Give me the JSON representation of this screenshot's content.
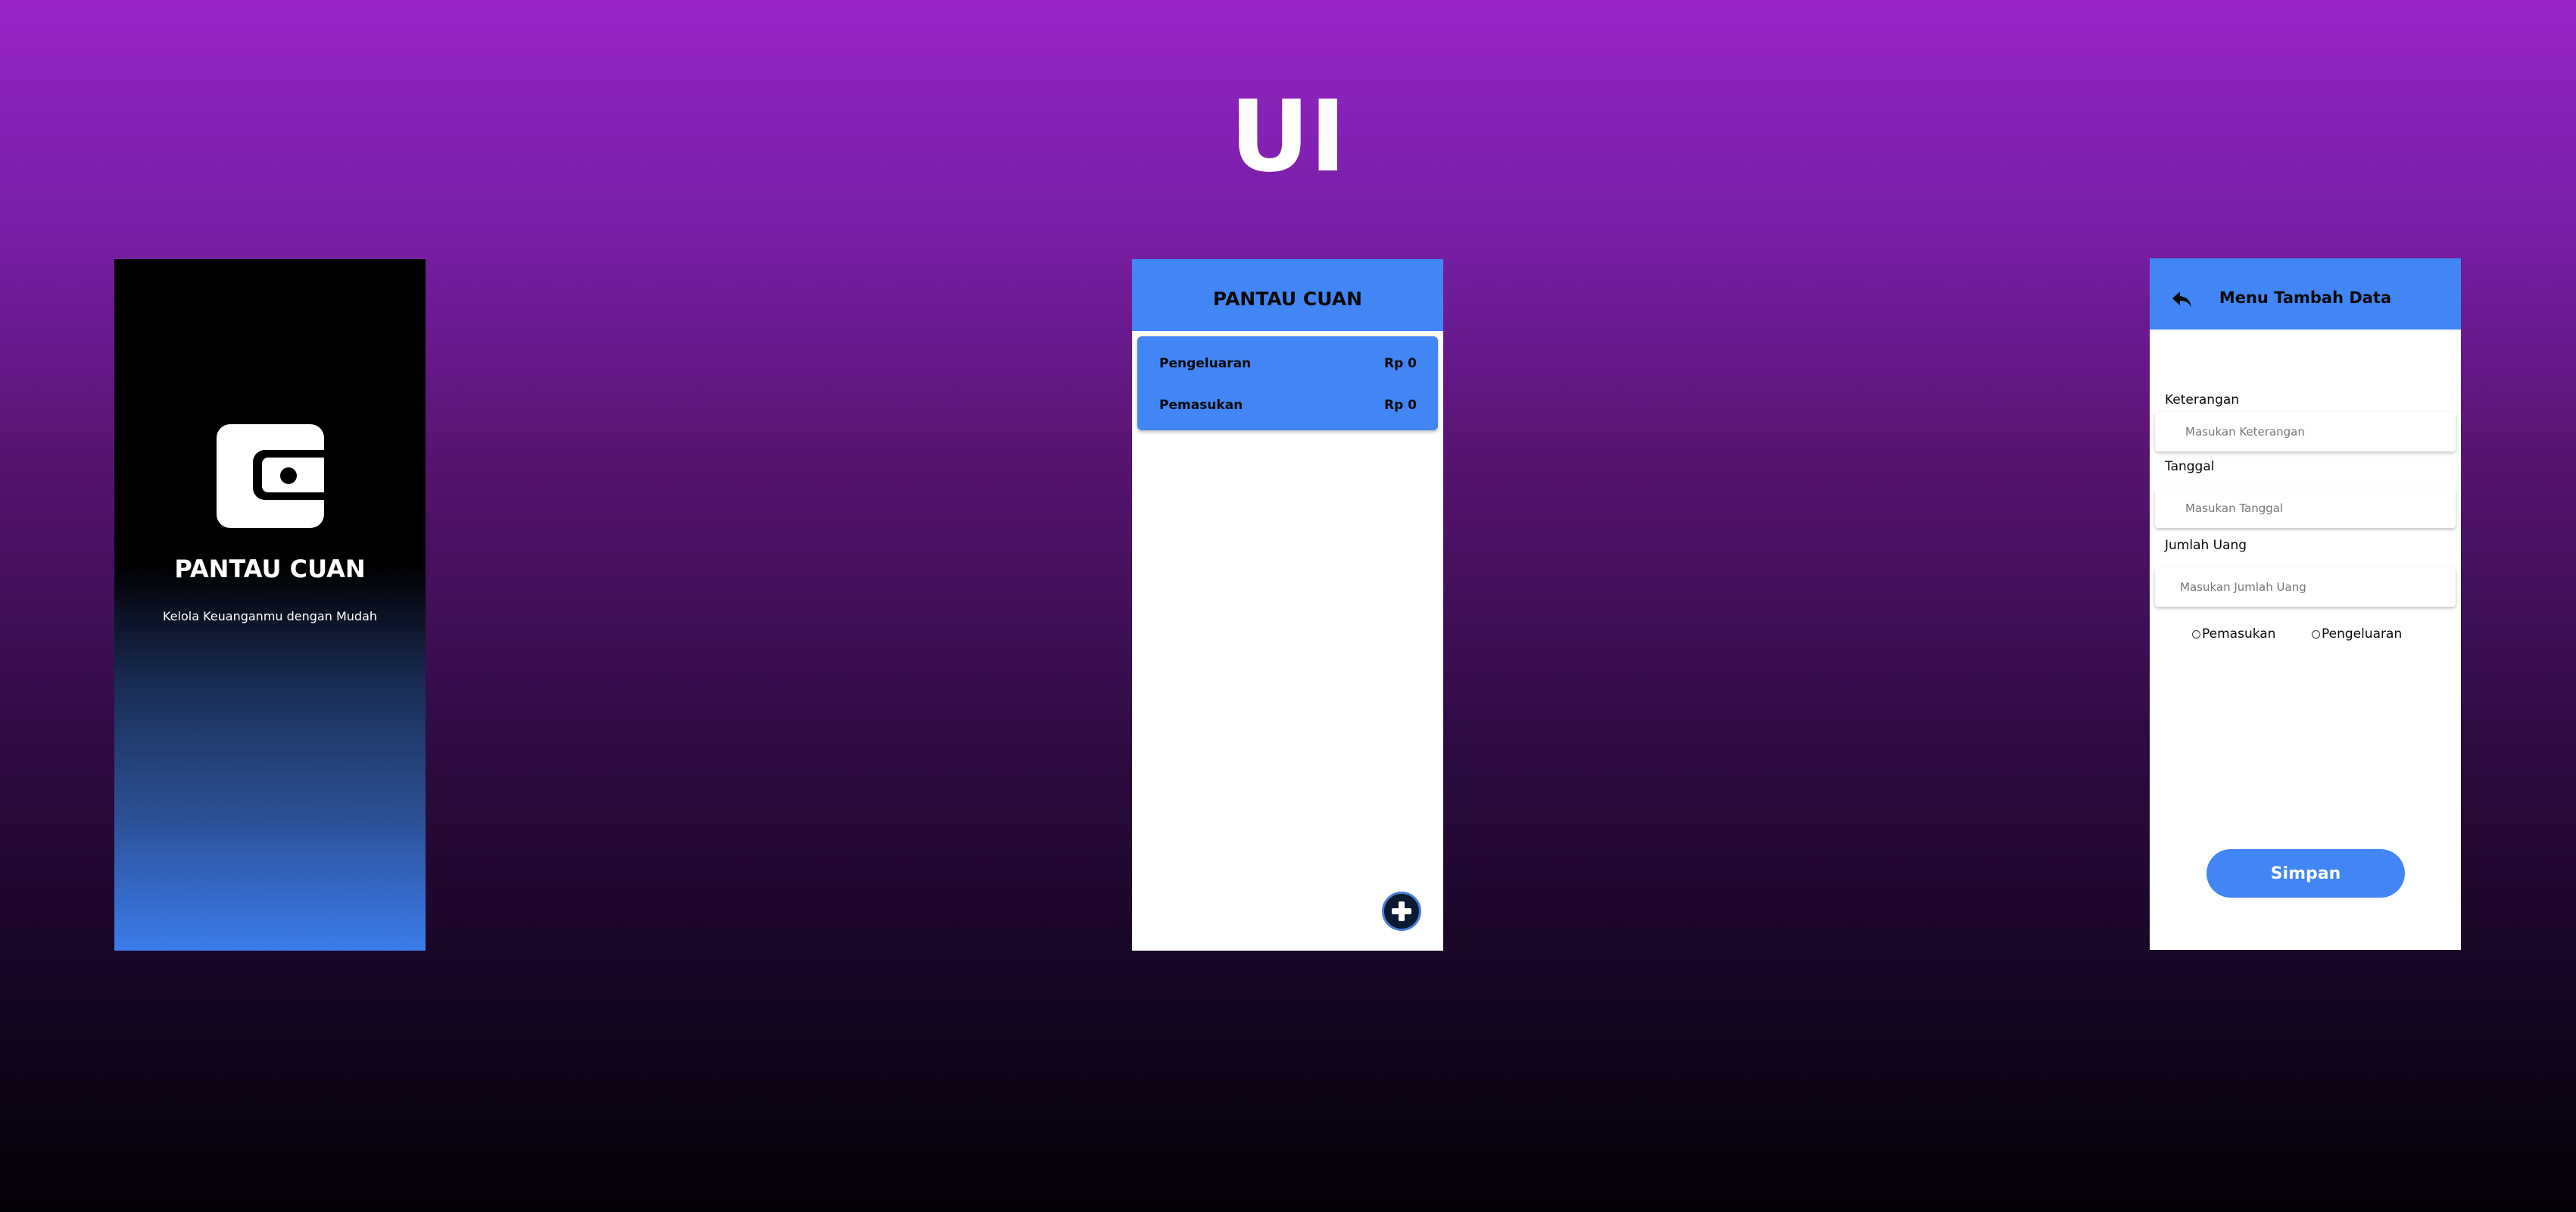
{
  "heading": "UI",
  "splash": {
    "title": "PANTAU CUAN",
    "subtitle": "Kelola Keuanganmu dengan Mudah",
    "logo_icon": "wallet-icon"
  },
  "home": {
    "title": "PANTAU CUAN",
    "summary": [
      {
        "label": "Pengeluaran",
        "amount": "Rp 0"
      },
      {
        "label": "Pemasukan",
        "amount": "Rp 0"
      }
    ],
    "fab_icon": "plus-icon"
  },
  "add_form": {
    "title": "Menu Tambah Data",
    "back_icon": "undo-arrow-icon",
    "fields": [
      {
        "label": "Keterangan",
        "placeholder": "Masukan Keterangan"
      },
      {
        "label": "Tanggal",
        "placeholder": "Masukan Tanggal"
      },
      {
        "label": "Jumlah Uang",
        "placeholder": "Masukan Jumlah Uang"
      }
    ],
    "radio_options": [
      "Pemasukan",
      "Pengeluaran"
    ],
    "submit_label": "Simpan"
  },
  "colors": {
    "accent": "#4285F4",
    "background_top": "#9624C6",
    "background_bottom": "#050108",
    "fab_bg": "#0B1A33"
  }
}
